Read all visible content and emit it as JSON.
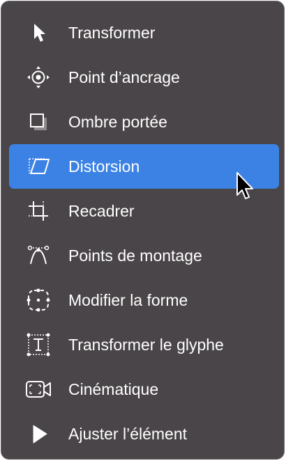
{
  "menu": {
    "selected_color": "#3b82e4",
    "background_color": "#4a4548",
    "items": [
      {
        "label": "Transformer",
        "icon": "arrow-pointer-icon"
      },
      {
        "label": "Point d’ancrage",
        "icon": "anchor-point-icon"
      },
      {
        "label": "Ombre portée",
        "icon": "drop-shadow-icon"
      },
      {
        "label": "Distorsion",
        "icon": "distort-icon",
        "selected": true
      },
      {
        "label": "Recadrer",
        "icon": "crop-icon"
      },
      {
        "label": "Points de montage",
        "icon": "edit-points-icon"
      },
      {
        "label": "Modifier la forme",
        "icon": "edit-shape-icon"
      },
      {
        "label": "Transformer le glyphe",
        "icon": "transform-glyph-icon"
      },
      {
        "label": "Cinématique",
        "icon": "ken-burns-icon"
      },
      {
        "label": "Ajuster l’élément",
        "icon": "adjust-item-icon"
      }
    ]
  }
}
